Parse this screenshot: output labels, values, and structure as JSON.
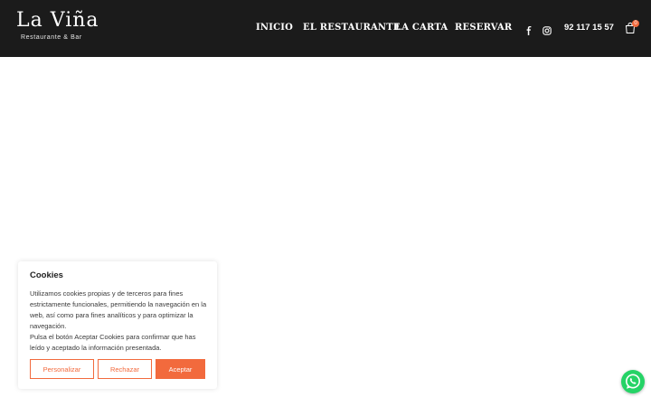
{
  "brand": {
    "name": "La Viña",
    "tagline": "Restaurante & Bar"
  },
  "nav": {
    "items": [
      "INICIO",
      "EL RESTAURANTE",
      "LA CARTA",
      "RESERVAR"
    ]
  },
  "social": {
    "icons": [
      "facebook-icon",
      "instagram-icon"
    ]
  },
  "contact": {
    "phone": "92 117 15 57"
  },
  "cart": {
    "count": "0",
    "icon": "shopping-bag-icon"
  },
  "cookies": {
    "title": "Cookies",
    "paragraph1": "Utilizamos cookies propias y de terceros para fines estrictamente funcionales, permitiendo la navegación en la web, así como para fines analíticos y para optimizar la navegación.",
    "paragraph2": "Pulsa el botón Aceptar Cookies para confirmar que has leído y aceptado la información presentada.",
    "buttons": {
      "customize": "Personalizar",
      "reject": "Rechazar",
      "accept": "Aceptar"
    }
  },
  "colors": {
    "header_bg": "#1b1b1b",
    "accent": "#f26a3d",
    "whatsapp": "#25d366"
  },
  "widgets": {
    "chat_icon": "whatsapp-icon"
  }
}
